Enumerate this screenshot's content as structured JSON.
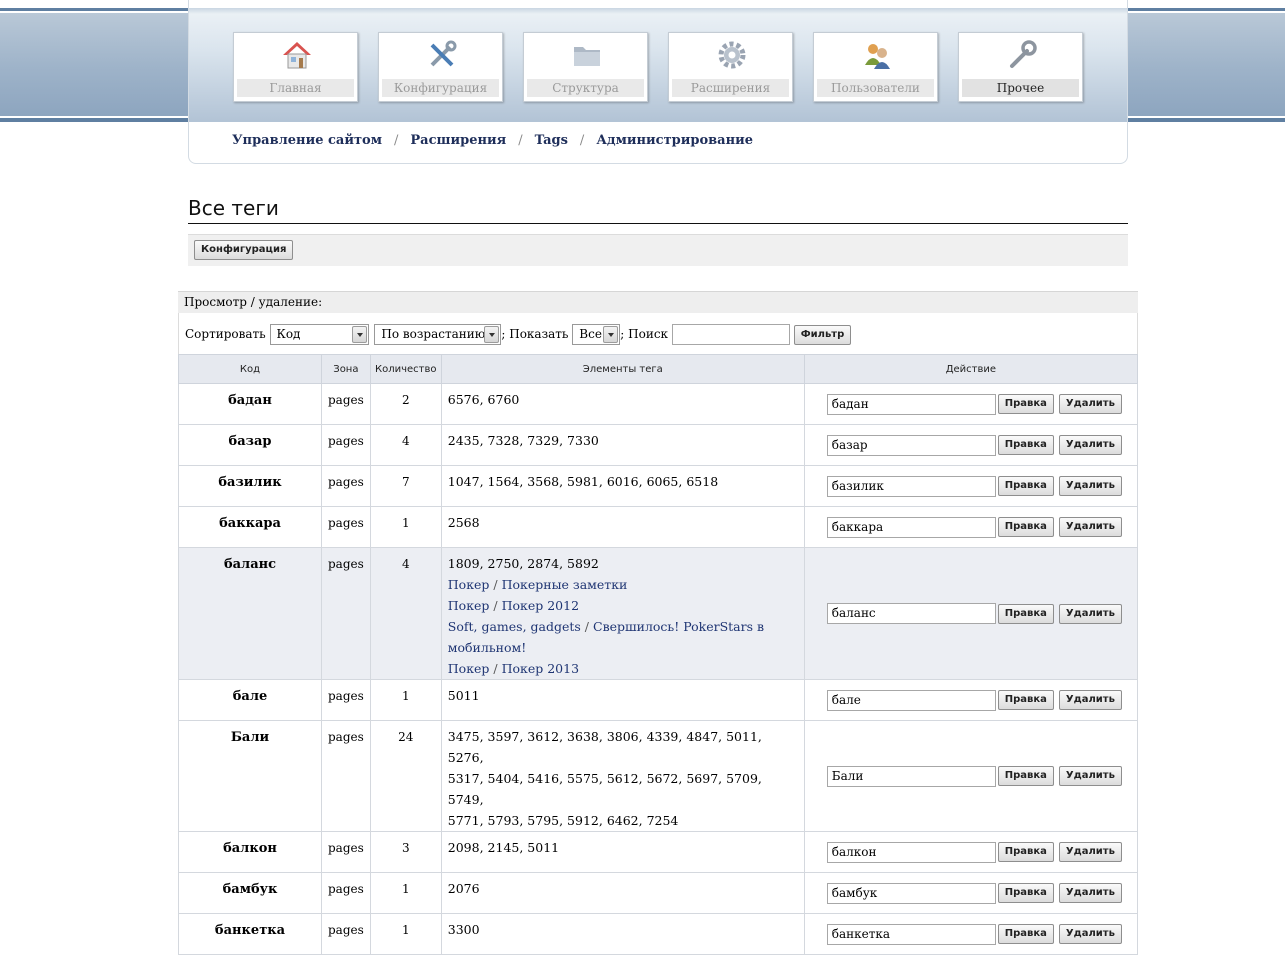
{
  "nav": {
    "tiles": [
      {
        "label": "Главная",
        "icon": "home-icon"
      },
      {
        "label": "Конфигурация",
        "icon": "tools-icon"
      },
      {
        "label": "Структура",
        "icon": "folder-icon"
      },
      {
        "label": "Расширения",
        "icon": "gear-icon"
      },
      {
        "label": "Пользователи",
        "icon": "users-icon"
      },
      {
        "label": "Прочее",
        "icon": "wrench-icon"
      }
    ],
    "active": "Прочее"
  },
  "breadcrumbs": [
    "Управление сайтом",
    "Расширения",
    "Tags",
    "Администрирование"
  ],
  "page_title": "Все теги",
  "toolbar": {
    "config_button": "Конфигурация"
  },
  "view_header": "Просмотр / удаление:",
  "filter": {
    "sort_label": "Сортировать",
    "sort_value": "Код",
    "order_value": "По возрастанию",
    "show_label": "; Показать",
    "show_value": "Все",
    "search_label": "; Поиск",
    "search_value": "",
    "filter_button": "Фильтр"
  },
  "table": {
    "headers": [
      "Код",
      "Зона",
      "Количество",
      "Элементы тега",
      "Действие"
    ],
    "edit_label": "Правка",
    "delete_label": "Удалить",
    "rows": [
      {
        "code": "бадан",
        "zone": "pages",
        "count": "2",
        "items": [
          "6576, 6760"
        ],
        "links": []
      },
      {
        "code": "базар",
        "zone": "pages",
        "count": "4",
        "items": [
          "2435, 7328, 7329, 7330"
        ],
        "links": []
      },
      {
        "code": "базилик",
        "zone": "pages",
        "count": "7",
        "items": [
          "1047, 1564, 3568, 5981, 6016, 6065, 6518"
        ],
        "links": []
      },
      {
        "code": "баккара",
        "zone": "pages",
        "count": "1",
        "items": [
          "2568"
        ],
        "links": []
      },
      {
        "code": "баланс",
        "zone": "pages",
        "count": "4",
        "items": [
          "1809, 2750, 2874, 5892"
        ],
        "links": [
          {
            "cat": "Покер",
            "title": "Покерные заметки"
          },
          {
            "cat": "Покер",
            "title": "Покер 2012"
          },
          {
            "cat": "Soft, games, gadgets",
            "title": "Свершилось! PokerStars в"
          },
          {
            "cat": "",
            "title": "мобильном!"
          },
          {
            "cat": "Покер",
            "title": "Покер 2013"
          }
        ]
      },
      {
        "code": "бале",
        "zone": "pages",
        "count": "1",
        "items": [
          "5011"
        ],
        "links": []
      },
      {
        "code": "Бали",
        "zone": "pages",
        "count": "24",
        "items": [
          "3475, 3597, 3612, 3638, 3806, 4339, 4847, 5011, 5276,",
          "5317, 5404, 5416, 5575, 5612, 5672, 5697, 5709, 5749,",
          "5771, 5793, 5795, 5912, 6462, 7254"
        ],
        "links": []
      },
      {
        "code": "балкон",
        "zone": "pages",
        "count": "3",
        "items": [
          "2098, 2145, 5011"
        ],
        "links": []
      },
      {
        "code": "бамбук",
        "zone": "pages",
        "count": "1",
        "items": [
          "2076"
        ],
        "links": []
      },
      {
        "code": "банкетка",
        "zone": "pages",
        "count": "1",
        "items": [
          "3300"
        ],
        "links": []
      }
    ]
  }
}
